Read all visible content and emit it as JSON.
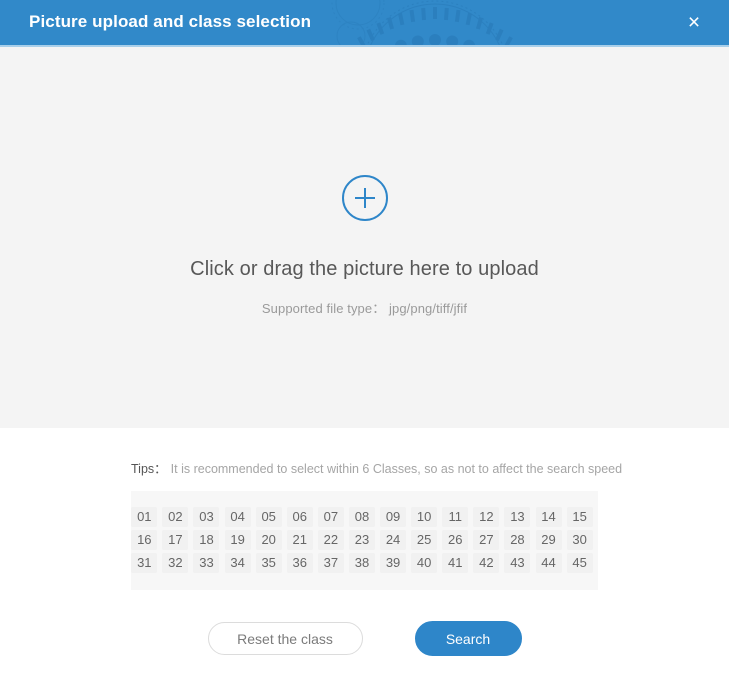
{
  "header": {
    "title": "Picture upload and class selection",
    "close_label": "×",
    "bg_color": "#3189c9",
    "underline_color": "#a8cfea"
  },
  "upload": {
    "icon": "plus-circle-icon",
    "main_text": "Click or drag the picture here to upload",
    "sub_text": "Supported file type： jpg/png/tiff/jfif",
    "bg_color": "#f4f4f4",
    "accent_color": "#2e86c9"
  },
  "tips": {
    "label": "Tips：",
    "text": "It is recommended to select within 6 Classes, so as not to affect the search speed"
  },
  "classes": {
    "items": [
      "01",
      "02",
      "03",
      "04",
      "05",
      "06",
      "07",
      "08",
      "09",
      "10",
      "11",
      "12",
      "13",
      "14",
      "15",
      "16",
      "17",
      "18",
      "19",
      "20",
      "21",
      "22",
      "23",
      "24",
      "25",
      "26",
      "27",
      "28",
      "29",
      "30",
      "31",
      "32",
      "33",
      "34",
      "35",
      "36",
      "37",
      "38",
      "39",
      "40",
      "41",
      "42",
      "43",
      "44",
      "45"
    ],
    "columns": 15,
    "chip_bg": "#f1f1f1",
    "panel_bg": "#f7f7f7"
  },
  "footer": {
    "reset_label": "Reset the class",
    "search_label": "Search",
    "search_color": "#2e86c9"
  }
}
